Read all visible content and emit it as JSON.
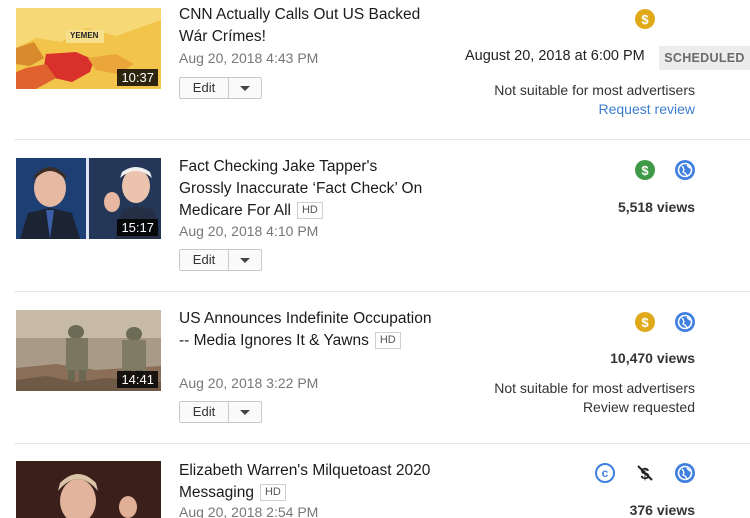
{
  "videos": [
    {
      "title": "CNN Actually Calls Out US Backed Wár Crímes!",
      "hd": "",
      "date": "Aug 20, 2018 4:43 PM",
      "duration": "10:37",
      "thumb_label": "YEMEN",
      "edit_label": "Edit",
      "scheduled_time": "August 20, 2018 at 6:00 PM",
      "badge": "SCHEDULED",
      "status": "Not suitable for most advertisers",
      "status2": "Request review",
      "icons": [
        "monetization-limited-icon"
      ]
    },
    {
      "title": "Fact Checking Jake Tapper's Grossly Inaccurate ‘Fact Check’ On Medicare For All",
      "hd": "HD",
      "date": "Aug 20, 2018 4:10 PM",
      "duration": "15:17",
      "edit_label": "Edit",
      "views": "5,518 views",
      "icons": [
        "monetization-on-icon",
        "public-globe-icon"
      ]
    },
    {
      "title": "US Announces Indefinite Occupation -- Media Ignores It & Yawns",
      "hd": "HD",
      "date": "Aug 20, 2018 3:22 PM",
      "duration": "14:41",
      "edit_label": "Edit",
      "views": "10,470 views",
      "status": "Not suitable for most advertisers",
      "status2": "Review requested",
      "icons": [
        "monetization-limited-icon",
        "public-globe-icon"
      ]
    },
    {
      "title": "Elizabeth Warren's Milquetoast 2020 Messaging",
      "hd": "HD",
      "date": "Aug 20, 2018 2:54 PM",
      "views": "376 views",
      "icons": [
        "copyright-icon",
        "monetization-off-icon",
        "public-globe-icon"
      ]
    }
  ],
  "colors": {
    "money_limited": "#e0a91a",
    "money_on": "#3f9a47",
    "globe": "#3f7fe0",
    "link": "#3c7ecf"
  }
}
